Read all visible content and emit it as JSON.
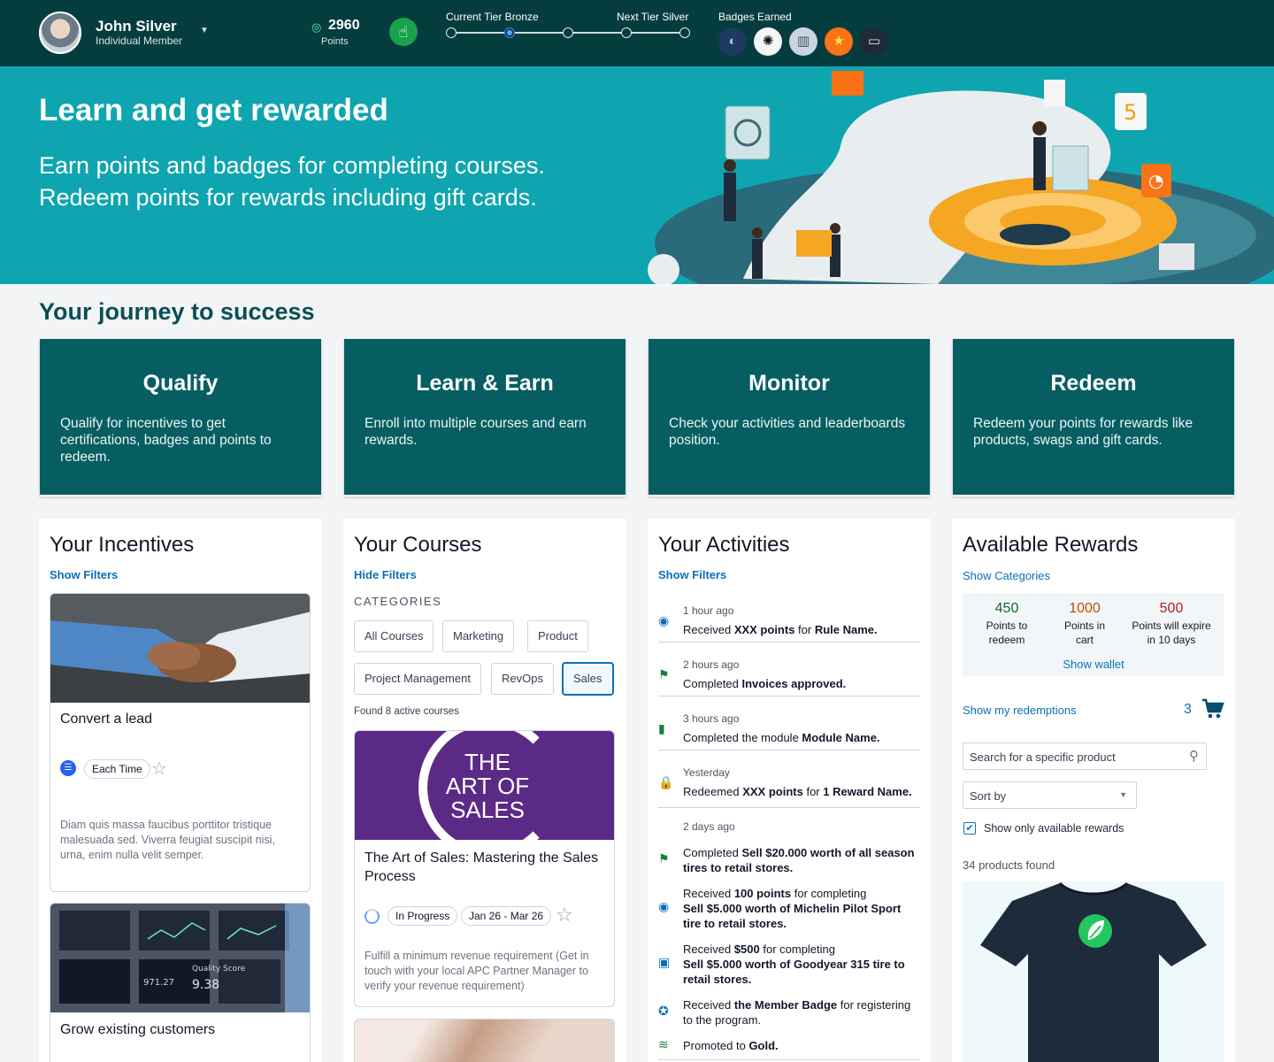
{
  "user": {
    "name": "John Silver",
    "role": "Individual Member"
  },
  "points": {
    "value": "2960",
    "label": "Points"
  },
  "tier": {
    "current": "Current Tier Bronze",
    "next": "Next Tier Silver",
    "progress_step": 2,
    "steps": 5
  },
  "badges": {
    "label": "Badges Earned",
    "items": [
      "globe-badge",
      "stamp-badge",
      "building-badge",
      "star-badge",
      "laptop-badge"
    ]
  },
  "hero": {
    "title": "Learn and get rewarded",
    "line1": "Earn points and badges for completing courses.",
    "line2": "Redeem points for rewards including gift cards."
  },
  "journey": {
    "title": "Your journey to success",
    "steps": [
      {
        "title": "Qualify",
        "text": "Qualify for incentives to get certifications, badges and points to redeem."
      },
      {
        "title": "Learn & Earn",
        "text": "Enroll into multiple courses and earn rewards."
      },
      {
        "title": "Monitor",
        "text": "Check your activities and leaderboards position."
      },
      {
        "title": "Redeem",
        "text": "Redeem your points for rewards like products, swags and gift cards."
      }
    ]
  },
  "incentives": {
    "title": "Your Incentives",
    "filter_link": "Show Filters",
    "items": [
      {
        "title": "Convert a lead",
        "frequency": "Each Time",
        "desc": "Diam quis massa faucibus porttitor tristique malesuada sed. Viverra feugiat suscipit nisi, urna, enim nulla velit semper."
      },
      {
        "title": "Grow existing customers",
        "chart_label": "Quality Score",
        "chart_value": "9.38",
        "chart_value2": "971.27"
      }
    ]
  },
  "courses": {
    "title": "Your Courses",
    "filter_link": "Hide Filters",
    "categories_label": "CATEGORIES",
    "categories": [
      "All Courses",
      "Marketing",
      "Product",
      "Project Management",
      "RevOps",
      "Sales"
    ],
    "selected": "Sales",
    "found": "Found 8 active courses",
    "items": [
      {
        "banner1": "THE",
        "banner2": "ART OF",
        "banner3": "SALES",
        "title": "The Art of Sales: Mastering the Sales Process",
        "status": "In Progress",
        "dates": "Jan 26 - Mar 26",
        "desc": "Fulfill a minimum revenue requirement  (Get in touch with your local APC Partner Manager to verify your revenue requirement)"
      }
    ]
  },
  "activities": {
    "title": "Your Activities",
    "filter_link": "Show Filters",
    "items": [
      {
        "time": "1 hour ago",
        "pre": "Received ",
        "b1": "XXX points",
        "mid": " for ",
        "b2": "Rule Name.",
        "post": "",
        "icon": "target-icon",
        "color": "#0b6fb8"
      },
      {
        "time": "2 hours ago",
        "pre": "Completed ",
        "b1": "Invoices approved.",
        "mid": "",
        "b2": "",
        "post": "",
        "icon": "flag-icon",
        "color": "#15803d"
      },
      {
        "time": "3 hours ago",
        "pre": "Completed the module ",
        "b1": "Module Name.",
        "mid": "",
        "b2": "",
        "post": "",
        "icon": "bookmark-icon",
        "color": "#15803d"
      },
      {
        "time": "Yesterday",
        "pre": "Redeemed ",
        "b1": "XXX points",
        "mid": " for ",
        "b2": "1 Reward Name.",
        "post": "",
        "icon": "bag-icon",
        "color": "#f59e0b"
      }
    ],
    "group": {
      "time": "2 days ago",
      "items": [
        {
          "pre": "Completed ",
          "b1": "Sell $20.000 worth of all season tires to retail stores.",
          "icon": "flag-icon",
          "color": "#15803d"
        },
        {
          "pre": "Received ",
          "b1": "100 points",
          "mid": " for completing",
          "b2": "Sell $5.000 worth of Michelin Pilot Sport tire to retail stores.",
          "icon": "target-icon",
          "color": "#0b6fb8"
        },
        {
          "pre": "Received ",
          "b1": "$500",
          "mid": " for completing",
          "b2": "Sell $5.000 worth of Goodyear 315 tire to retail stores.",
          "icon": "cash-icon",
          "color": "#0b6fb8"
        },
        {
          "pre": "Received ",
          "b1": "the Member Badge",
          "mid": " for registering to the program.",
          "icon": "award-icon",
          "color": "#0b6fb8"
        },
        {
          "pre": "Promoted to ",
          "b1": "Gold.",
          "icon": "layers-icon",
          "color": "#15803d"
        }
      ]
    }
  },
  "rewards": {
    "title": "Available Rewards",
    "categories_link": "Show Categories",
    "stats": [
      {
        "value": "450",
        "label": "Points to redeem",
        "color": "#166534"
      },
      {
        "value": "1000",
        "label": "Points in cart",
        "color": "#b45309"
      },
      {
        "value": "500",
        "label": "Points will expire in 10 days",
        "color": "#b91c1c"
      }
    ],
    "wallet_link": "Show wallet",
    "redemptions_link": "Show my redemptions",
    "cart_count": "3",
    "search_placeholder": "Search for a specific product",
    "sort_label": "Sort by",
    "only_available": "Show only available rewards",
    "found": "34 products found"
  }
}
